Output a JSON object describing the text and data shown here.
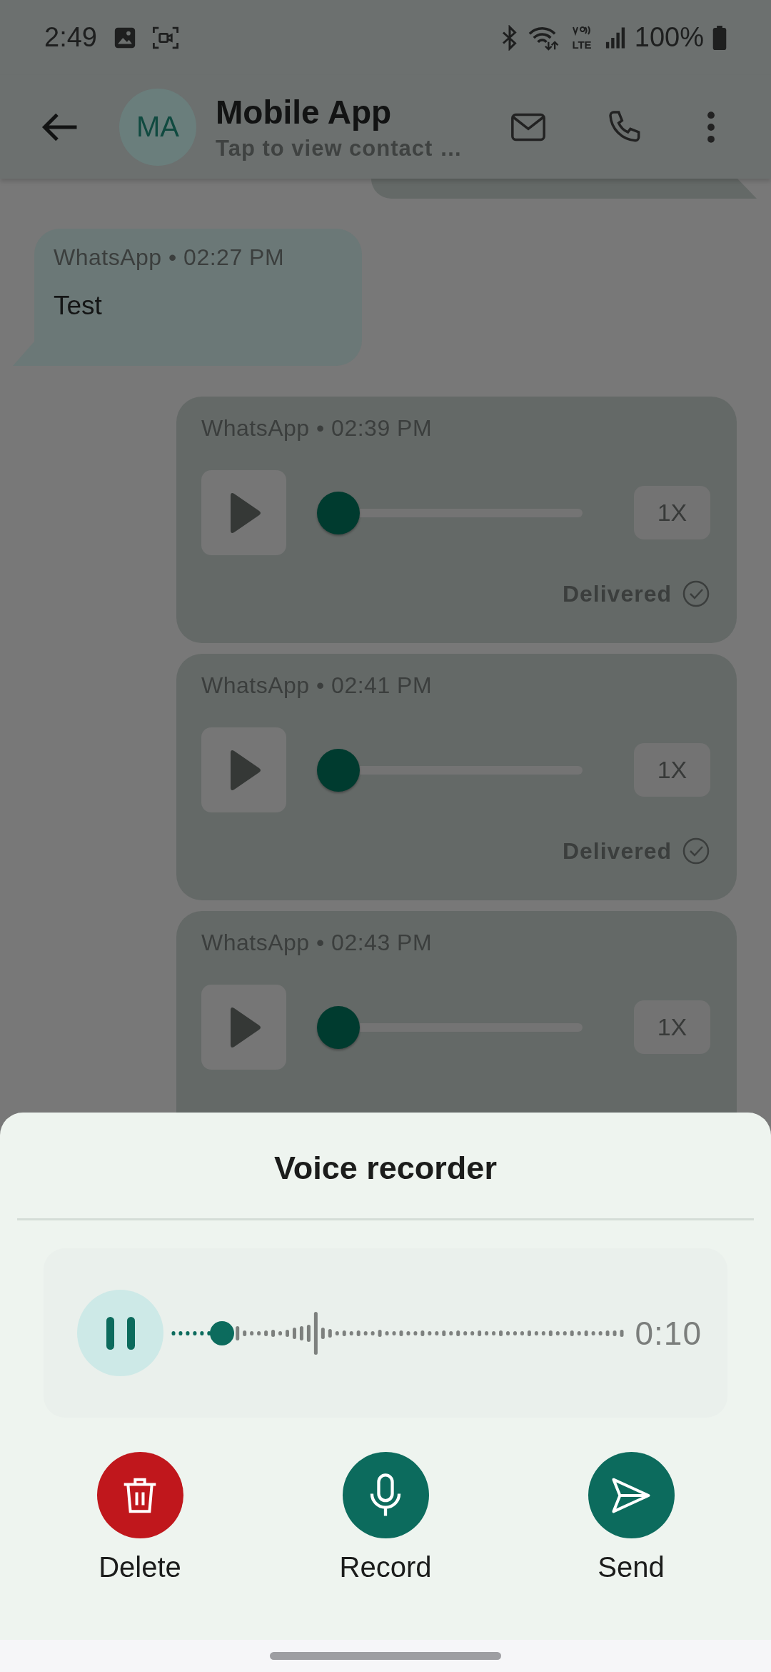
{
  "status_bar": {
    "time": "2:49",
    "network": "LTE",
    "battery": "100%"
  },
  "header": {
    "avatar_initials": "MA",
    "title": "Mobile App",
    "subtitle": "Tap to view contact …"
  },
  "messages": [
    {
      "kind": "clipped"
    },
    {
      "kind": "text",
      "meta": "WhatsApp • 02:27 PM",
      "text": "Test"
    },
    {
      "kind": "voice",
      "meta": "WhatsApp • 02:39 PM",
      "level": 0,
      "speed": "1X",
      "status": "Delivered"
    },
    {
      "kind": "voice",
      "meta": "WhatsApp • 02:41 PM",
      "level": 0,
      "speed": "1X",
      "status": "Delivered"
    },
    {
      "kind": "voice",
      "meta": "WhatsApp • 02:43 PM",
      "level": 0,
      "speed": "1X"
    }
  ],
  "recorder": {
    "title": "Voice recorder",
    "level": 0.06,
    "elapsed": "0:10",
    "actions": [
      {
        "kind": "delete",
        "label": "Delete"
      },
      {
        "kind": "record",
        "label": "Record"
      },
      {
        "kind": "send",
        "label": "Send"
      }
    ]
  }
}
